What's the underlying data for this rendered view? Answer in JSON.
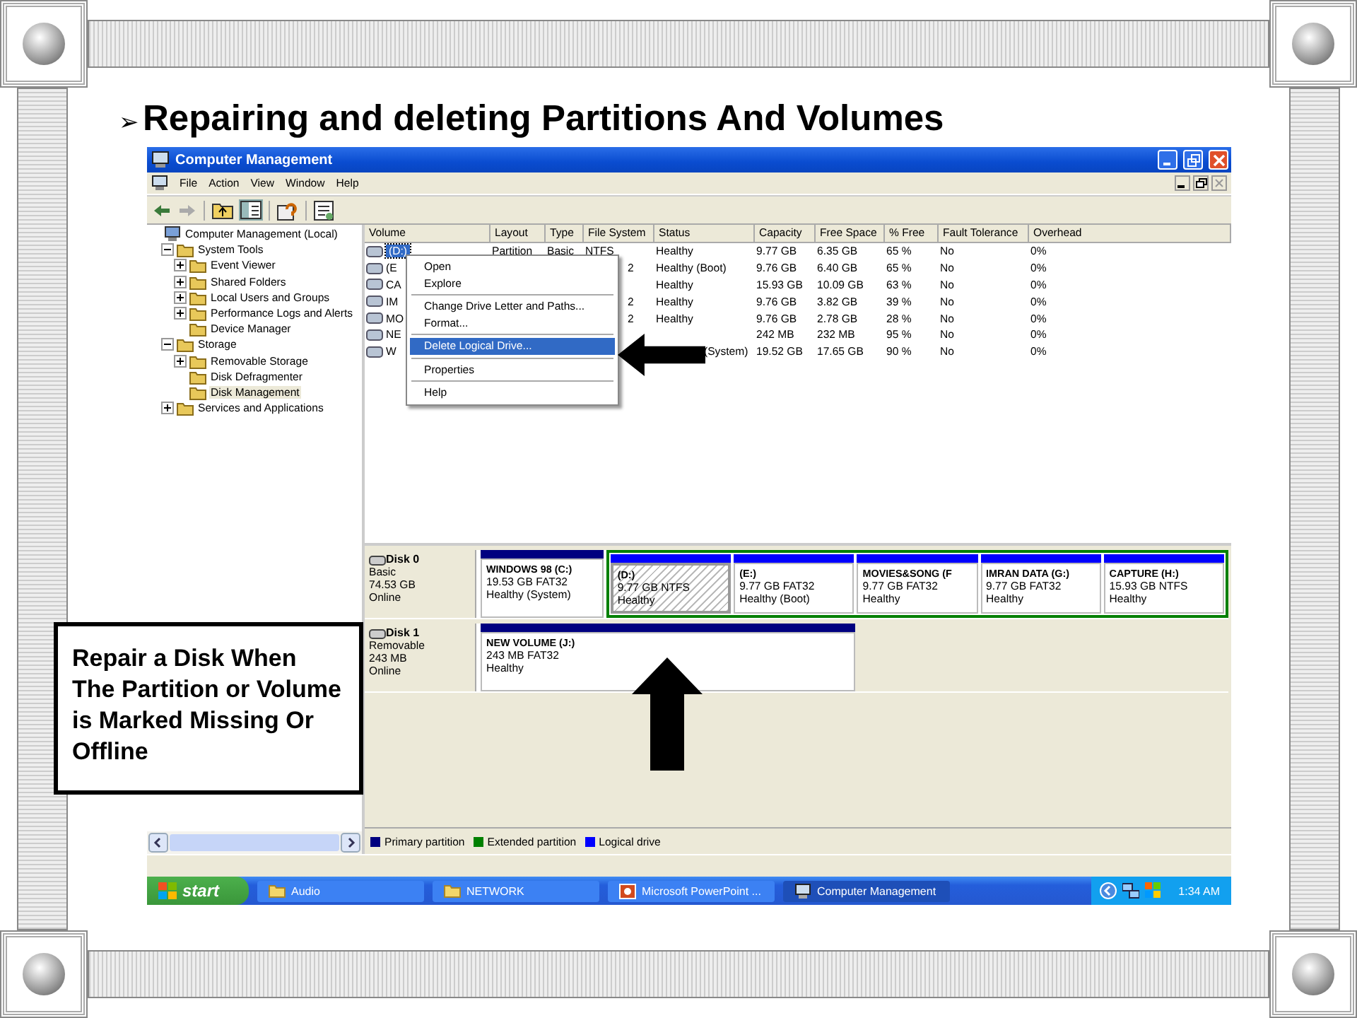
{
  "slide": {
    "bullet": "➢",
    "title": "Repairing and deleting Partitions And Volumes"
  },
  "window": {
    "title": "Computer Management",
    "menu": [
      "File",
      "Action",
      "View",
      "Window",
      "Help"
    ]
  },
  "tree": [
    {
      "label": "Computer Management (Local)",
      "selected": false,
      "children": [
        {
          "label": "System Tools",
          "selected": false,
          "expanded": true,
          "children": [
            {
              "label": "Event Viewer",
              "selected": false,
              "expanded": false
            },
            {
              "label": "Shared Folders",
              "selected": false,
              "expanded": false
            },
            {
              "label": "Local Users and Groups",
              "selected": false,
              "expanded": false
            },
            {
              "label": "Performance Logs and Alerts",
              "selected": false,
              "expanded": false
            },
            {
              "label": "Device Manager",
              "selected": false
            }
          ]
        },
        {
          "label": "Storage",
          "selected": false,
          "expanded": true,
          "children": [
            {
              "label": "Removable Storage",
              "selected": false,
              "expanded": false
            },
            {
              "label": "Disk Defragmenter",
              "selected": false
            },
            {
              "label": "Disk Management",
              "selected": true
            }
          ]
        },
        {
          "label": "Services and Applications",
          "selected": false,
          "expanded": false
        }
      ]
    }
  ],
  "table": {
    "columns": [
      "Volume",
      "Layout",
      "Type",
      "File System",
      "Status",
      "Capacity",
      "Free Space",
      "% Free",
      "Fault Tolerance",
      "Overhead"
    ],
    "rows": [
      {
        "selected": true,
        "volume": "(D:)",
        "layout": "Partition",
        "type": "Basic",
        "file_system": "NTFS",
        "status": "Healthy",
        "capacity": "9.77 GB",
        "free_space": "6.35 GB",
        "pct_free": "65 %",
        "fault_tolerance": "No",
        "overhead": "0%"
      },
      {
        "selected": false,
        "volume": "(E",
        "file_system_tail": "2",
        "status": "Healthy (Boot)",
        "capacity": "9.76 GB",
        "free_space": "6.40 GB",
        "pct_free": "65 %",
        "fault_tolerance": "No",
        "overhead": "0%"
      },
      {
        "selected": false,
        "volume": "CA",
        "status": "Healthy",
        "capacity": "15.93 GB",
        "free_space": "10.09 GB",
        "pct_free": "63 %",
        "fault_tolerance": "No",
        "overhead": "0%"
      },
      {
        "selected": false,
        "volume": "IM",
        "file_system_tail": "2",
        "status": "Healthy",
        "capacity": "9.76 GB",
        "free_space": "3.82 GB",
        "pct_free": "39 %",
        "fault_tolerance": "No",
        "overhead": "0%"
      },
      {
        "selected": false,
        "volume": "MO",
        "file_system_tail": "2",
        "status": "Healthy",
        "capacity": "9.76 GB",
        "free_space": "2.78 GB",
        "pct_free": "28 %",
        "fault_tolerance": "No",
        "overhead": "0%"
      },
      {
        "selected": false,
        "volume": "NE",
        "capacity": "242 MB",
        "free_space": "232 MB",
        "pct_free": "95 %",
        "fault_tolerance": "No",
        "overhead": "0%"
      },
      {
        "selected": false,
        "volume": "W",
        "status_tail": "(System)",
        "capacity": "19.52 GB",
        "free_space": "17.65 GB",
        "pct_free": "90 %",
        "fault_tolerance": "No",
        "overhead": "0%"
      }
    ]
  },
  "context_menu": [
    {
      "label": "Open",
      "selected": false
    },
    {
      "label": "Explore",
      "selected": false,
      "separator_after": true
    },
    {
      "label": "Change Drive Letter and Paths...",
      "selected": false
    },
    {
      "label": "Format...",
      "selected": false,
      "separator_after": true
    },
    {
      "label": "Delete Logical Drive...",
      "selected": true,
      "separator_after": true
    },
    {
      "label": "Properties",
      "selected": false,
      "separator_after": true
    },
    {
      "label": "Help",
      "selected": false
    }
  ],
  "disks": [
    {
      "name": "Disk 0",
      "type": "Basic",
      "size": "74.53 GB",
      "state": "Online",
      "partitions": [
        {
          "kind": "primary",
          "selected": false,
          "name": "WINDOWS 98  (C:)",
          "detail": "19.53 GB FAT32",
          "status": "Healthy (System)"
        },
        {
          "kind": "extended",
          "partitions": [
            {
              "kind": "logical",
              "selected": true,
              "name": "(D:)",
              "detail": "9.77 GB NTFS",
              "status": "Healthy"
            },
            {
              "kind": "logical",
              "selected": false,
              "name": "(E:)",
              "detail": "9.77 GB FAT32",
              "status": "Healthy (Boot)"
            },
            {
              "kind": "logical",
              "selected": false,
              "name": "MOVIES&SONG  (F",
              "detail": "9.77 GB FAT32",
              "status": "Healthy"
            },
            {
              "kind": "logical",
              "selected": false,
              "name": "IMRAN DATA  (G:)",
              "detail": "9.77 GB FAT32",
              "status": "Healthy"
            },
            {
              "kind": "logical",
              "selected": false,
              "name": "CAPTURE  (H:)",
              "detail": "15.93 GB NTFS",
              "status": "Healthy"
            }
          ]
        }
      ]
    },
    {
      "name": "Disk 1",
      "type": "Removable",
      "size": "243 MB",
      "state": "Online",
      "partitions": [
        {
          "kind": "primary",
          "selected": false,
          "name": "NEW VOLUME  (J:)",
          "detail": "243 MB FAT32",
          "status": "Healthy"
        }
      ]
    }
  ],
  "legend": [
    {
      "label": "Primary partition",
      "color": "#000080"
    },
    {
      "label": "Extended partition",
      "color": "#008000"
    },
    {
      "label": "Logical drive",
      "color": "#0000ff"
    }
  ],
  "callout": "Repair a Disk When The Partition or Volume is Marked Missing Or Offline",
  "taskbar": {
    "start": "start",
    "tasks": [
      {
        "label": "Audio",
        "kind": "folder",
        "selected": false
      },
      {
        "label": "NETWORK",
        "kind": "folder",
        "selected": false
      },
      {
        "label": "Microsoft PowerPoint ...",
        "kind": "slides",
        "selected": false
      },
      {
        "label": "Computer Management",
        "kind": "computer",
        "selected": true
      }
    ],
    "time": "1:34 AM"
  }
}
